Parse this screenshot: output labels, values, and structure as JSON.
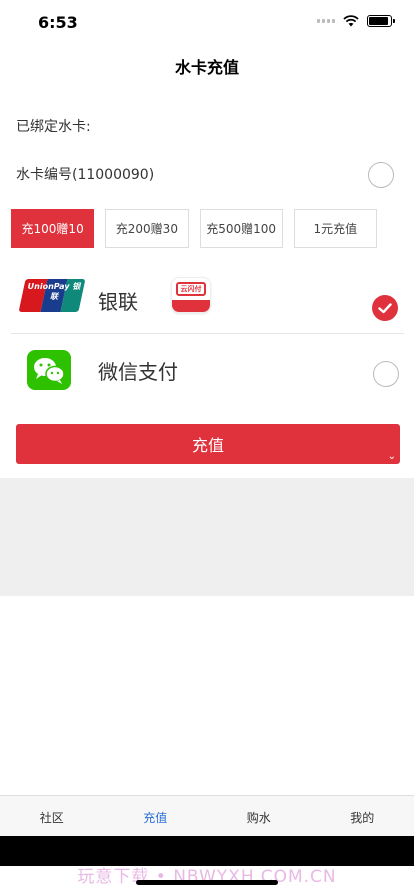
{
  "status_bar": {
    "time": "6:53"
  },
  "page_title": "水卡充值",
  "bound_card": {
    "label": "已绑定水卡:",
    "card_text": "水卡编号(11000090)"
  },
  "amount_options": [
    {
      "label": "充100赠10",
      "selected": true
    },
    {
      "label": "充200赠30",
      "selected": false
    },
    {
      "label": "充500赠100",
      "selected": false
    },
    {
      "label": "1元充值",
      "selected": false
    }
  ],
  "payment_methods": {
    "unionpay": {
      "name": "银联",
      "logo_text": "UnionPay 银联",
      "quickpass_text": "云闪付",
      "selected": true
    },
    "wechat": {
      "name": "微信支付",
      "selected": false
    }
  },
  "submit_button": {
    "label": "充值"
  },
  "tab_bar": {
    "tabs": [
      {
        "label": "社区",
        "active": false
      },
      {
        "label": "充值",
        "active": true
      },
      {
        "label": "购水",
        "active": false
      },
      {
        "label": "我的",
        "active": false
      }
    ]
  },
  "watermark": "玩意下载 • NBWYXH.COM.CN",
  "colors": {
    "primary": "#e0323c",
    "active_tab": "#2a6fd6",
    "wechat_green": "#2dc100"
  }
}
